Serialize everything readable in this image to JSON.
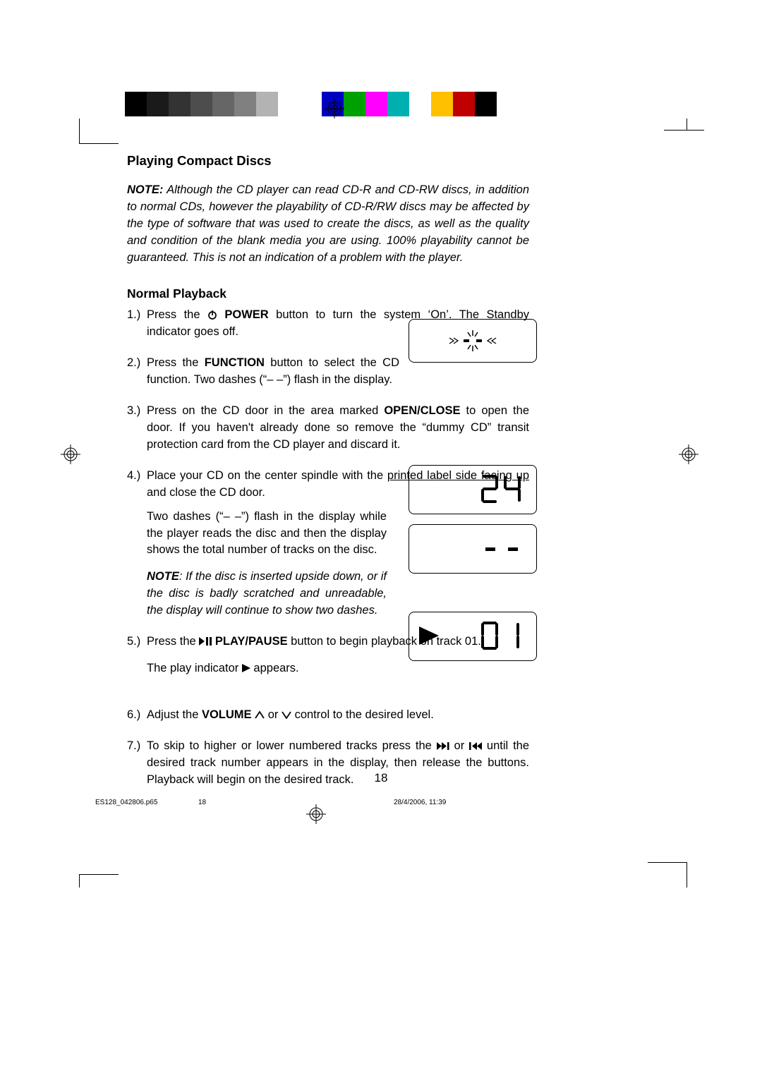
{
  "heading": "Playing Compact Discs",
  "note_label": "NOTE:",
  "note_body": " Although the CD player can read CD-R and CD-RW discs, in addition to normal CDs, however the playability of CD-R/RW discs may be affected by the type of software that was used to create the discs, as well as the quality and condition of the blank media you are using. 100% playability cannot be guaranteed. This is not an indication of a problem with the player.",
  "subheading": "Normal Playback",
  "steps": {
    "s1_num": "1.)",
    "s1_a": "Press the ",
    "s1_power": " POWER",
    "s1_b": " button to turn the system ‘On’. The Standby indicator goes off.",
    "s2_num": "2.)",
    "s2_a": "Press the ",
    "s2_function": "FUNCTION",
    "s2_b": " button to select the CD function. Two dashes (“– –”) flash in the display.",
    "s3_num": "3.)",
    "s3_a": "Press on the CD door in the area marked ",
    "s3_open": "OPEN/CLOSE",
    "s3_b": " to open the door. If you haven't already done so remove the “dummy CD” transit protection card from the CD player and discard it.",
    "s4_num": "4.)",
    "s4_a": "Place your CD on the center spindle with the ",
    "s4_ul": "printed label side facing up",
    "s4_b": " and close the CD door.",
    "s4_sub": "Two dashes (“– –”) flash in the display while the player reads the disc and then the display shows the total number of tracks on the disc.",
    "s4_note_label": "NOTE",
    "s4_note_body": ": If the disc is inserted upside down, or if the disc is badly scratched and unreadable, the display will continue to show two dashes.",
    "s5_num": "5.)",
    "s5_a": "Press the ",
    "s5_play": " PLAY/PAUSE",
    "s5_b": " button to begin playback on track 01.",
    "s5_sub_a": "The play indicator ",
    "s5_sub_b": " appears.",
    "s6_num": "6.)",
    "s6_a": "Adjust the ",
    "s6_volume": "VOLUME",
    "s6_b": " or ",
    "s6_c": " control to the desired level.",
    "s7_num": "7.)",
    "s7_a": "To skip to higher or lower numbered tracks press the ",
    "s7_b": " or ",
    "s7_c": " until the desired track number appears in the display, then release the buttons. Playback will begin on the desired track."
  },
  "displays": {
    "dashes_symbol": "–  –",
    "tracks": "24",
    "dashes2": "-  -",
    "current": "0 1"
  },
  "page_number": "18",
  "footer": {
    "file": "ES128_042806.p65",
    "page": "18",
    "date": "28/4/2006, 11:39"
  },
  "colorbar": [
    "#000000",
    "#1a1a1a",
    "#333333",
    "#4d4d4d",
    "#666666",
    "#808080",
    "#b3b3b3",
    "#ffffff",
    "#ffffff",
    "#0000c0",
    "#00a000",
    "#ff00ff",
    "#00b0b0",
    "#ffffff",
    "#ffc000",
    "#c00000",
    "#000000"
  ]
}
